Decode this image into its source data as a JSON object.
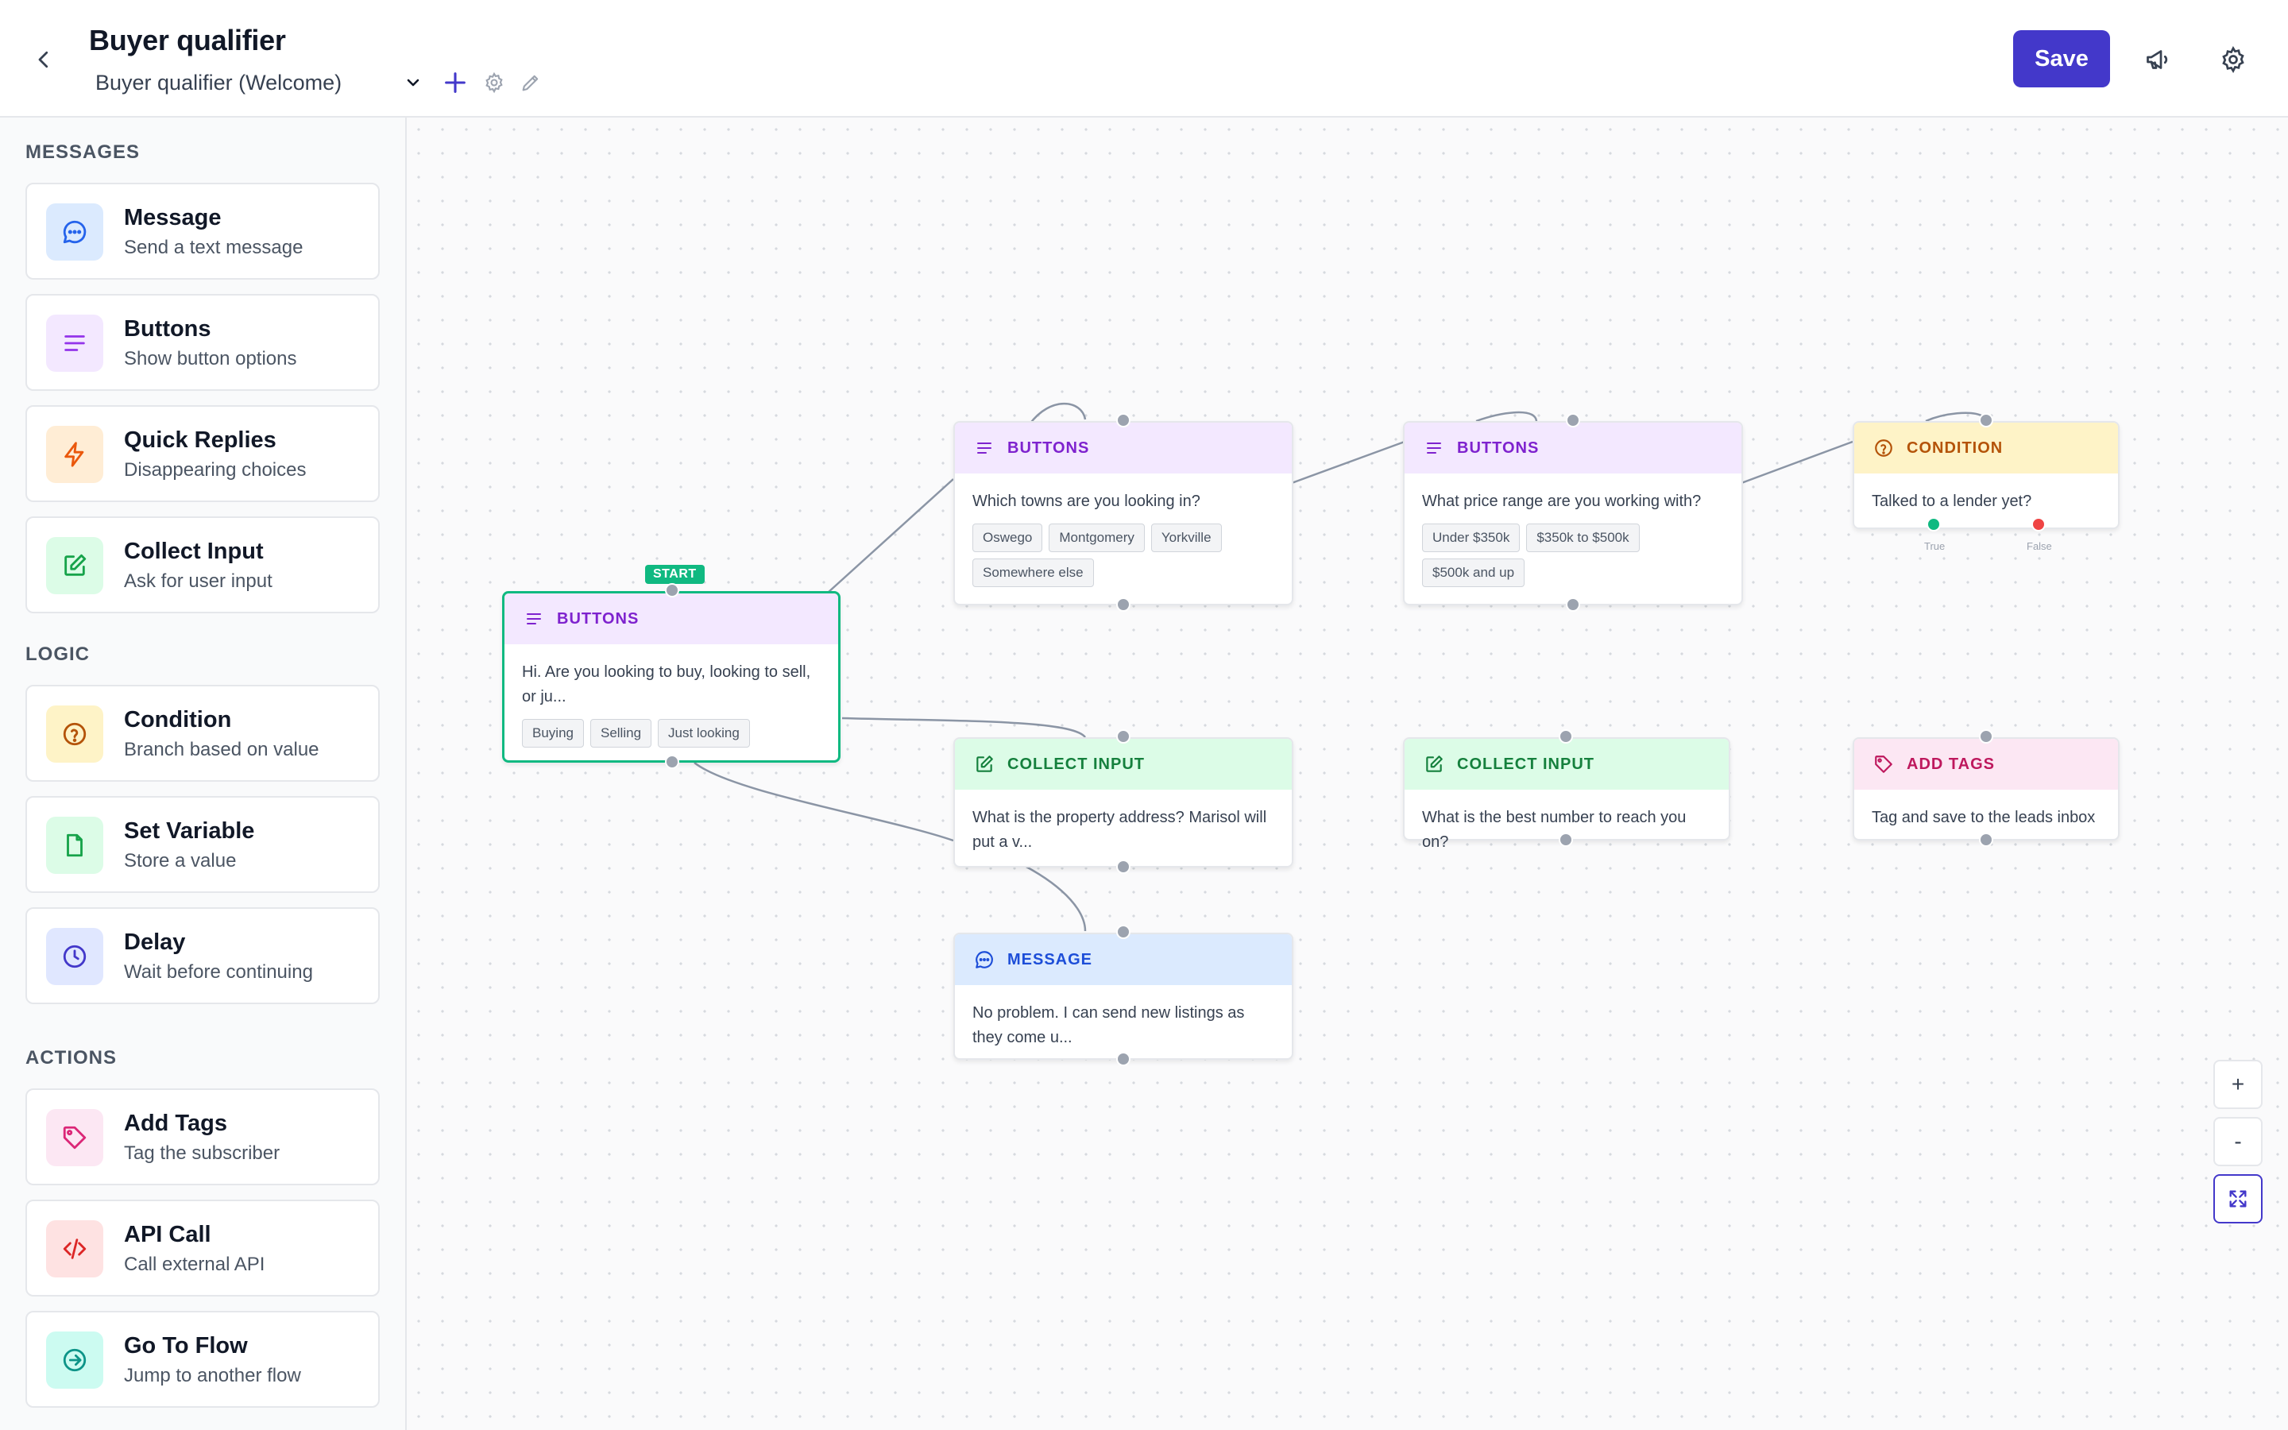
{
  "header": {
    "title": "Buyer qualifier",
    "flow_name": "Buyer qualifier (Welcome)",
    "save_label": "Save"
  },
  "sidebar": {
    "sections": [
      {
        "title": "MESSAGES",
        "items": [
          {
            "name": "Message",
            "desc": "Send a text message",
            "icon": "chat-bubble-icon",
            "color": "#2563eb",
            "bg": "#dbeafe"
          },
          {
            "name": "Buttons",
            "desc": "Show button options",
            "icon": "lines-icon",
            "color": "#9333ea",
            "bg": "#f3e8ff"
          },
          {
            "name": "Quick Replies",
            "desc": "Disappearing choices",
            "icon": "lightning-icon",
            "color": "#ea580c",
            "bg": "#ffedd5"
          },
          {
            "name": "Collect Input",
            "desc": "Ask for user input",
            "icon": "edit-icon",
            "color": "#16a34a",
            "bg": "#dcfce7"
          }
        ]
      },
      {
        "title": "LOGIC",
        "items": [
          {
            "name": "Condition",
            "desc": "Branch based on value",
            "icon": "question-circle-icon",
            "color": "#b45309",
            "bg": "#fef3c7"
          },
          {
            "name": "Set Variable",
            "desc": "Store a value",
            "icon": "file-icon",
            "color": "#16a34a",
            "bg": "#dcfce7"
          },
          {
            "name": "Delay",
            "desc": "Wait before continuing",
            "icon": "clock-icon",
            "color": "#4338ca",
            "bg": "#e0e7ff"
          }
        ]
      },
      {
        "title": "ACTIONS",
        "items": [
          {
            "name": "Add Tags",
            "desc": "Tag the subscriber",
            "icon": "tag-icon",
            "color": "#db2777",
            "bg": "#fce7f3"
          },
          {
            "name": "API Call",
            "desc": "Call external API",
            "icon": "code-icon",
            "color": "#dc2626",
            "bg": "#fee2e2"
          },
          {
            "name": "Go To Flow",
            "desc": "Jump to another flow",
            "icon": "arrow-circle-icon",
            "color": "#0d9488",
            "bg": "#ccfbf1"
          }
        ]
      }
    ]
  },
  "canvas": {
    "start_badge": "START",
    "nodes": {
      "start": {
        "type": "BUTTONS",
        "text": "Hi. Are you looking to buy, looking to sell, or ju...",
        "chips": [
          "Buying",
          "Selling",
          "Just looking"
        ]
      },
      "towns": {
        "type": "BUTTONS",
        "text": "Which towns are you looking in?",
        "chips": [
          "Oswego",
          "Montgomery",
          "Yorkville",
          "Somewhere else"
        ]
      },
      "price": {
        "type": "BUTTONS",
        "text": "What price range are you working with?",
        "chips": [
          "Under $350k",
          "$350k to $500k",
          "$500k and up"
        ]
      },
      "lender": {
        "type": "CONDITION",
        "text": "Talked to a lender yet?",
        "true_label": "True",
        "false_label": "False"
      },
      "address": {
        "type": "COLLECT INPUT",
        "text": "What is the property address? Marisol will put a v..."
      },
      "phone": {
        "type": "COLLECT INPUT",
        "text": "What is the best number to reach you on?"
      },
      "tags": {
        "type": "ADD TAGS",
        "text": "Tag and save to the leads inbox"
      },
      "listings": {
        "type": "MESSAGE",
        "text": "No problem. I can send new listings as they come u..."
      }
    },
    "zoom_controls": {
      "zoom_in": "+",
      "zoom_out": "-"
    }
  },
  "colors": {
    "accent": "#4338ca",
    "selected": "#10b981",
    "edge": "#8b95a5"
  }
}
